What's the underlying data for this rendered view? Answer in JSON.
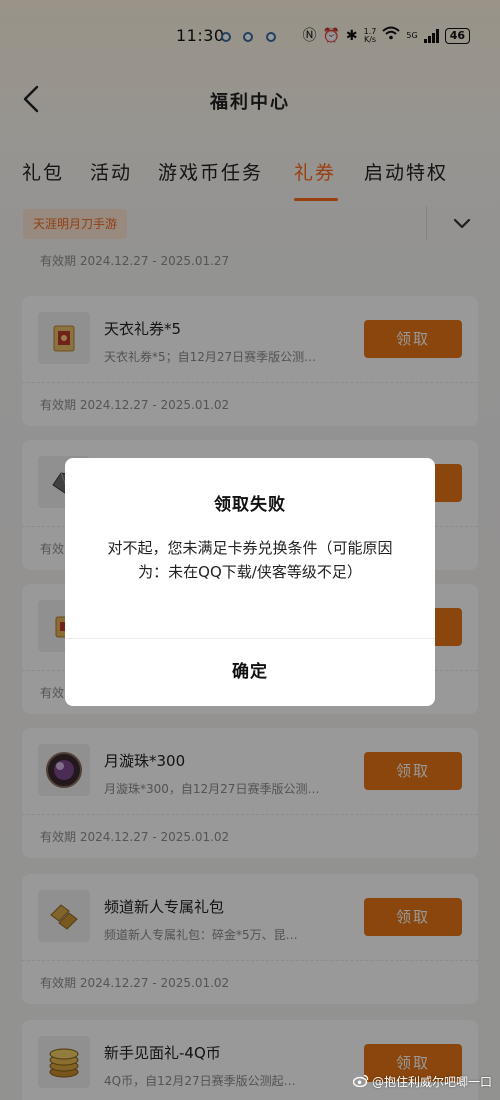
{
  "status_bar": {
    "time": "11:30",
    "net_speed_top": "1.7",
    "net_speed_bottom": "K/s",
    "network_type": "5G",
    "battery": "46"
  },
  "header": {
    "title": "福利中心"
  },
  "tabs": [
    {
      "label": "礼包",
      "active": false
    },
    {
      "label": "活动",
      "active": false
    },
    {
      "label": "游戏币任务",
      "active": false
    },
    {
      "label": "礼券",
      "active": true
    },
    {
      "label": "启动特权",
      "active": false
    }
  ],
  "filter": {
    "game_label": "天涯明月刀手游"
  },
  "top_validity": "有效期 2024.12.27 - 2025.01.27",
  "coupons": [
    {
      "title": "天衣礼券*5",
      "desc": "天衣礼券*5；自12月27日赛季版公测…",
      "button": "领取",
      "validity": "有效期 2024.12.27 - 2025.01.02"
    },
    {
      "title": "",
      "desc": "",
      "button": "领取",
      "validity": "有效"
    },
    {
      "title": "",
      "desc": "",
      "button": "领取",
      "validity": "有效"
    },
    {
      "title": "月漩珠*300",
      "desc": "月漩珠*300，自12月27日赛季版公测…",
      "button": "领取",
      "validity": "有效期 2024.12.27 - 2025.01.02"
    },
    {
      "title": "频道新人专属礼包",
      "desc": "频道新人专属礼包：碎金*5万、昆…",
      "button": "领取",
      "validity": "有效期 2024.12.27 - 2025.01.02"
    },
    {
      "title": "新手见面礼-4Q币",
      "desc": "4Q币，自12月27日赛季版公测起…",
      "button": "领取",
      "validity": ""
    }
  ],
  "dialog": {
    "title": "领取失败",
    "message": "对不起，您未满足卡券兑换条件（可能原因为：未在QQ下载/侠客等级不足）",
    "confirm": "确定"
  },
  "watermark": "@抱住利威尔吧唧一口",
  "colors": {
    "accent": "#ff6a1a",
    "button": "#e67515",
    "chip_bg": "#fde6d2"
  }
}
